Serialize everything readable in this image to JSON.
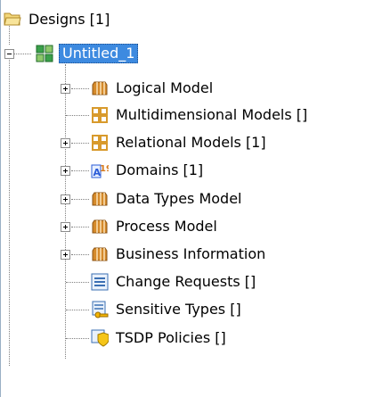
{
  "root": {
    "label": "Designs [1]",
    "icon": "folder-open-icon"
  },
  "design": {
    "label": "Untitled_1",
    "icon": "design-icon",
    "selected": true
  },
  "items": [
    {
      "label": "Logical Model",
      "icon": "model-cube-icon",
      "expandable": true
    },
    {
      "label": "Multidimensional Models []",
      "icon": "grid-models-icon",
      "expandable": false
    },
    {
      "label": "Relational Models [1]",
      "icon": "grid-models-icon",
      "expandable": true
    },
    {
      "label": "Domains [1]",
      "icon": "domains-icon",
      "expandable": true
    },
    {
      "label": "Data Types Model",
      "icon": "model-cube-icon",
      "expandable": true
    },
    {
      "label": "Process Model",
      "icon": "model-cube-icon",
      "expandable": true
    },
    {
      "label": "Business Information",
      "icon": "model-cube-icon",
      "expandable": true
    },
    {
      "label": "Change Requests []",
      "icon": "change-requests-icon",
      "expandable": false
    },
    {
      "label": "Sensitive Types []",
      "icon": "sensitive-types-icon",
      "expandable": false
    },
    {
      "label": "TSDP Policies []",
      "icon": "tsdp-policies-icon",
      "expandable": false
    }
  ],
  "colors": {
    "selection": "#3d8ae0",
    "cube": "#d58a2b",
    "grid": "#d89a2c",
    "border": "#9ab0c4"
  }
}
